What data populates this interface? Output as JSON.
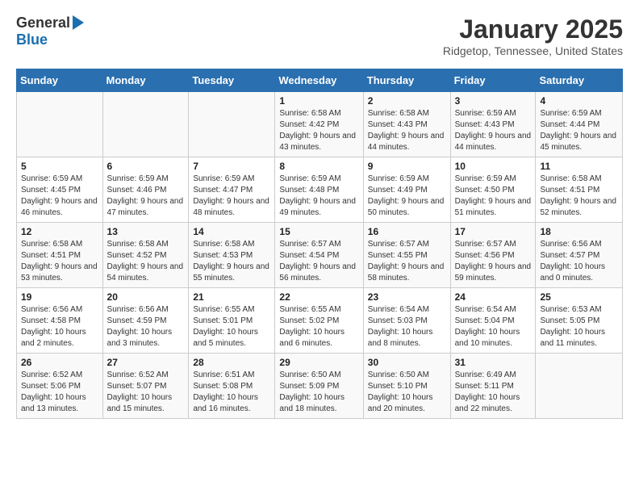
{
  "logo": {
    "general": "General",
    "blue": "Blue"
  },
  "title": "January 2025",
  "location": "Ridgetop, Tennessee, United States",
  "headers": [
    "Sunday",
    "Monday",
    "Tuesday",
    "Wednesday",
    "Thursday",
    "Friday",
    "Saturday"
  ],
  "weeks": [
    [
      {
        "day": "",
        "info": ""
      },
      {
        "day": "",
        "info": ""
      },
      {
        "day": "",
        "info": ""
      },
      {
        "day": "1",
        "info": "Sunrise: 6:58 AM\nSunset: 4:42 PM\nDaylight: 9 hours and 43 minutes."
      },
      {
        "day": "2",
        "info": "Sunrise: 6:58 AM\nSunset: 4:43 PM\nDaylight: 9 hours and 44 minutes."
      },
      {
        "day": "3",
        "info": "Sunrise: 6:59 AM\nSunset: 4:43 PM\nDaylight: 9 hours and 44 minutes."
      },
      {
        "day": "4",
        "info": "Sunrise: 6:59 AM\nSunset: 4:44 PM\nDaylight: 9 hours and 45 minutes."
      }
    ],
    [
      {
        "day": "5",
        "info": "Sunrise: 6:59 AM\nSunset: 4:45 PM\nDaylight: 9 hours and 46 minutes."
      },
      {
        "day": "6",
        "info": "Sunrise: 6:59 AM\nSunset: 4:46 PM\nDaylight: 9 hours and 47 minutes."
      },
      {
        "day": "7",
        "info": "Sunrise: 6:59 AM\nSunset: 4:47 PM\nDaylight: 9 hours and 48 minutes."
      },
      {
        "day": "8",
        "info": "Sunrise: 6:59 AM\nSunset: 4:48 PM\nDaylight: 9 hours and 49 minutes."
      },
      {
        "day": "9",
        "info": "Sunrise: 6:59 AM\nSunset: 4:49 PM\nDaylight: 9 hours and 50 minutes."
      },
      {
        "day": "10",
        "info": "Sunrise: 6:59 AM\nSunset: 4:50 PM\nDaylight: 9 hours and 51 minutes."
      },
      {
        "day": "11",
        "info": "Sunrise: 6:58 AM\nSunset: 4:51 PM\nDaylight: 9 hours and 52 minutes."
      }
    ],
    [
      {
        "day": "12",
        "info": "Sunrise: 6:58 AM\nSunset: 4:51 PM\nDaylight: 9 hours and 53 minutes."
      },
      {
        "day": "13",
        "info": "Sunrise: 6:58 AM\nSunset: 4:52 PM\nDaylight: 9 hours and 54 minutes."
      },
      {
        "day": "14",
        "info": "Sunrise: 6:58 AM\nSunset: 4:53 PM\nDaylight: 9 hours and 55 minutes."
      },
      {
        "day": "15",
        "info": "Sunrise: 6:57 AM\nSunset: 4:54 PM\nDaylight: 9 hours and 56 minutes."
      },
      {
        "day": "16",
        "info": "Sunrise: 6:57 AM\nSunset: 4:55 PM\nDaylight: 9 hours and 58 minutes."
      },
      {
        "day": "17",
        "info": "Sunrise: 6:57 AM\nSunset: 4:56 PM\nDaylight: 9 hours and 59 minutes."
      },
      {
        "day": "18",
        "info": "Sunrise: 6:56 AM\nSunset: 4:57 PM\nDaylight: 10 hours and 0 minutes."
      }
    ],
    [
      {
        "day": "19",
        "info": "Sunrise: 6:56 AM\nSunset: 4:58 PM\nDaylight: 10 hours and 2 minutes."
      },
      {
        "day": "20",
        "info": "Sunrise: 6:56 AM\nSunset: 4:59 PM\nDaylight: 10 hours and 3 minutes."
      },
      {
        "day": "21",
        "info": "Sunrise: 6:55 AM\nSunset: 5:01 PM\nDaylight: 10 hours and 5 minutes."
      },
      {
        "day": "22",
        "info": "Sunrise: 6:55 AM\nSunset: 5:02 PM\nDaylight: 10 hours and 6 minutes."
      },
      {
        "day": "23",
        "info": "Sunrise: 6:54 AM\nSunset: 5:03 PM\nDaylight: 10 hours and 8 minutes."
      },
      {
        "day": "24",
        "info": "Sunrise: 6:54 AM\nSunset: 5:04 PM\nDaylight: 10 hours and 10 minutes."
      },
      {
        "day": "25",
        "info": "Sunrise: 6:53 AM\nSunset: 5:05 PM\nDaylight: 10 hours and 11 minutes."
      }
    ],
    [
      {
        "day": "26",
        "info": "Sunrise: 6:52 AM\nSunset: 5:06 PM\nDaylight: 10 hours and 13 minutes."
      },
      {
        "day": "27",
        "info": "Sunrise: 6:52 AM\nSunset: 5:07 PM\nDaylight: 10 hours and 15 minutes."
      },
      {
        "day": "28",
        "info": "Sunrise: 6:51 AM\nSunset: 5:08 PM\nDaylight: 10 hours and 16 minutes."
      },
      {
        "day": "29",
        "info": "Sunrise: 6:50 AM\nSunset: 5:09 PM\nDaylight: 10 hours and 18 minutes."
      },
      {
        "day": "30",
        "info": "Sunrise: 6:50 AM\nSunset: 5:10 PM\nDaylight: 10 hours and 20 minutes."
      },
      {
        "day": "31",
        "info": "Sunrise: 6:49 AM\nSunset: 5:11 PM\nDaylight: 10 hours and 22 minutes."
      },
      {
        "day": "",
        "info": ""
      }
    ]
  ]
}
